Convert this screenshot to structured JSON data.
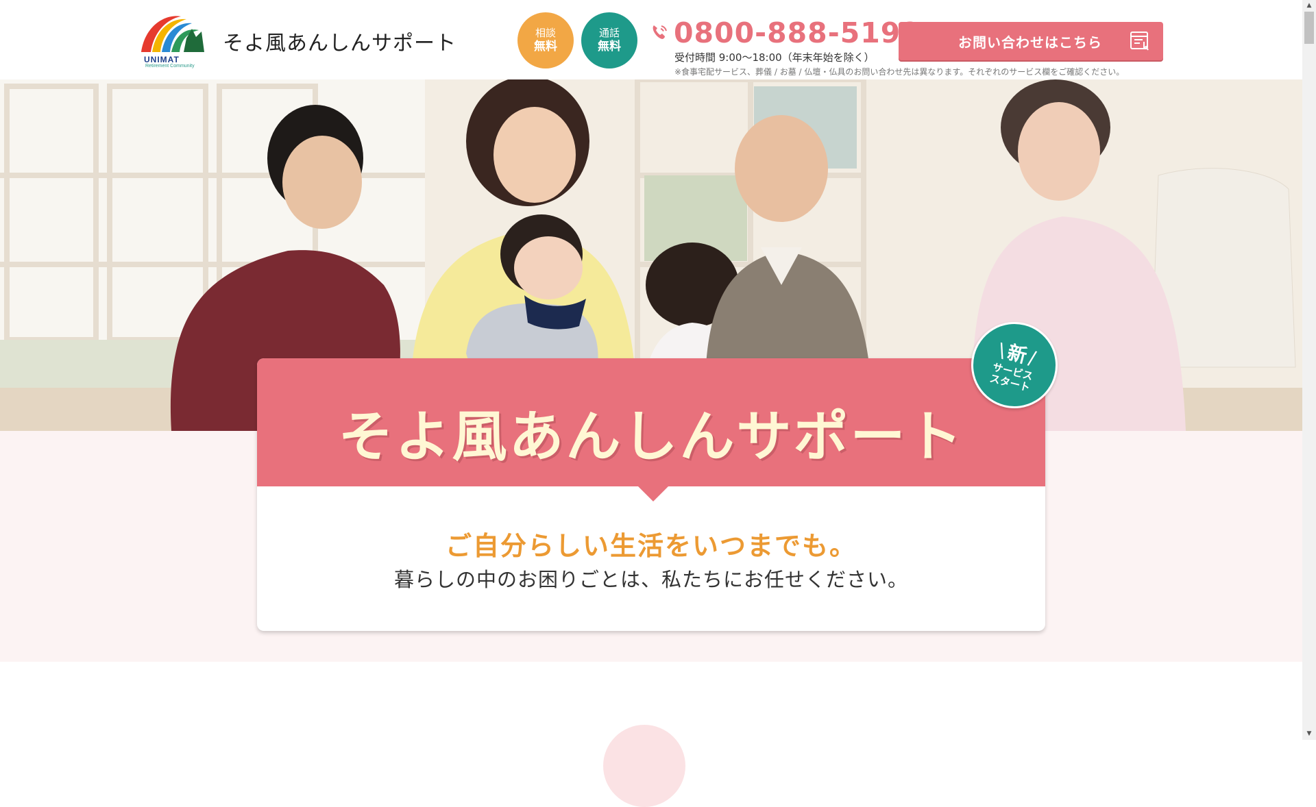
{
  "header": {
    "logo": {
      "brand": "UNIMAT",
      "sub": "Retirement Community"
    },
    "site_title": "そよ風あんしんサポート",
    "badge_consult": {
      "line1": "相談",
      "line2": "無料"
    },
    "badge_call": {
      "line1": "通話",
      "line2": "無料"
    },
    "phone_icon": "phone-icon",
    "phone_number": "0800-888-5192",
    "hours": "受付時間 9:00〜18:00（年末年始を除く）",
    "notice": "※食事宅配サービス、葬儀 / お墓 / 仏壇・仏具のお問い合わせ先は異なります。それぞれのサービス欄をご確認ください。",
    "contact_button": {
      "label": "お問い合わせはこちら",
      "icon": "form-icon"
    }
  },
  "hero": {
    "new_badge": {
      "line1": "新",
      "line2": "サービス",
      "line3": "スタート"
    },
    "title": "そよ風あんしんサポート",
    "tagline": "ご自分らしい生活をいつまでも。",
    "subline": "暮らしの中のお困りごとは、私たちにお任せください。"
  },
  "colors": {
    "accent_pink": "#e8717c",
    "teal": "#1e9a8a",
    "orange": "#f2a745",
    "tagline_orange": "#ec9a33",
    "title_cream": "#fff7d4",
    "section_bg": "#fcf3f3"
  },
  "scrollbar": {
    "up": "▲",
    "down": "▼"
  }
}
